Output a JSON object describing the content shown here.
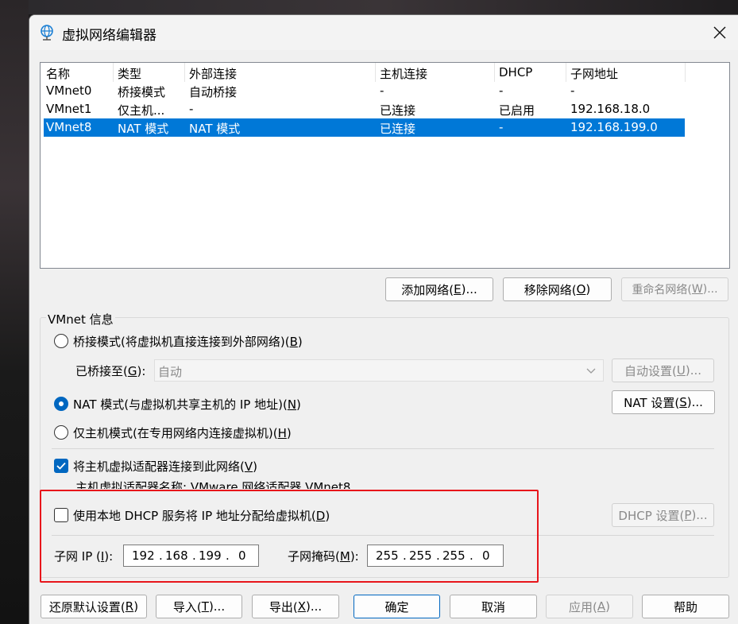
{
  "window": {
    "title": "虚拟网络编辑器",
    "icon": "globe-network-icon",
    "close_icon": "close-icon"
  },
  "table": {
    "columns": [
      "名称",
      "类型",
      "外部连接",
      "主机连接",
      "DHCP",
      "子网地址"
    ],
    "rows": [
      [
        "VMnet0",
        "桥接模式",
        "自动桥接",
        "-",
        "-",
        "-"
      ],
      [
        "VMnet1",
        "仅主机...",
        "-",
        "已连接",
        "已启用",
        "192.168.18.0"
      ],
      [
        "VMnet8",
        "NAT 模式",
        "NAT 模式",
        "已连接",
        "-",
        "192.168.199.0"
      ]
    ],
    "selected_row": 2
  },
  "buttons": {
    "add_network": {
      "label": "添加网络(",
      "key": "E",
      "suffix": ")..."
    },
    "remove_network": {
      "label": "移除网络(",
      "key": "O",
      "suffix": ")"
    },
    "rename_network": {
      "label": "重命名网络(",
      "key": "W",
      "suffix": ")..."
    }
  },
  "vmnet_info": {
    "group_label": "VMnet 信息",
    "bridged": {
      "label": "桥接模式(将虚拟机直接连接到外部网络)(",
      "key": "B",
      "suffix": ")",
      "checked": false
    },
    "bridged_to": {
      "label": "已桥接至(",
      "key": "G",
      "suffix": "):",
      "value": "自动"
    },
    "auto_settings": {
      "label": "自动设置(",
      "key": "U",
      "suffix": ")..."
    },
    "nat": {
      "label": "NAT 模式(与虚拟机共享主机的 IP 地址)(",
      "key": "N",
      "suffix": ")",
      "checked": true
    },
    "nat_settings": {
      "label": "NAT 设置(",
      "key": "S",
      "suffix": ")..."
    },
    "host_only": {
      "label": "仅主机模式(在专用网络内连接虚拟机)(",
      "key": "H",
      "suffix": ")",
      "checked": false
    },
    "connect_adapter": {
      "label": "将主机虚拟适配器连接到此网络(",
      "key": "V",
      "suffix": ")",
      "checked": true
    },
    "adapter_name": "主机虚拟适配器名称: VMware 网络适配器 VMnet8",
    "use_dhcp": {
      "label": "使用本地 DHCP 服务将 IP 地址分配给虚拟机(",
      "key": "D",
      "suffix": ")",
      "checked": false
    },
    "dhcp_settings": {
      "label": "DHCP 设置(",
      "key": "P",
      "suffix": ")..."
    },
    "subnet_ip": {
      "label": "子网 IP (",
      "key": "I",
      "suffix": "):",
      "octets": [
        "192",
        "168",
        "199",
        "0"
      ]
    },
    "subnet_mask": {
      "label": "子网掩码(",
      "key": "M",
      "suffix": "):",
      "octets": [
        "255",
        "255",
        "255",
        "0"
      ]
    }
  },
  "footer": {
    "restore": {
      "label": "还原默认设置(",
      "key": "R",
      "suffix": ")"
    },
    "import": {
      "label": "导入(",
      "key": "T",
      "suffix": ")..."
    },
    "export": {
      "label": "导出(",
      "key": "X",
      "suffix": ")..."
    },
    "ok": {
      "label": "确定"
    },
    "cancel": {
      "label": "取消"
    },
    "apply": {
      "label": "应用(",
      "key": "A",
      "suffix": ")"
    },
    "help": {
      "label": "帮助"
    }
  },
  "colors": {
    "selection": "#0078d7",
    "accent": "#0067c0",
    "highlight_box": "#e8151b"
  }
}
